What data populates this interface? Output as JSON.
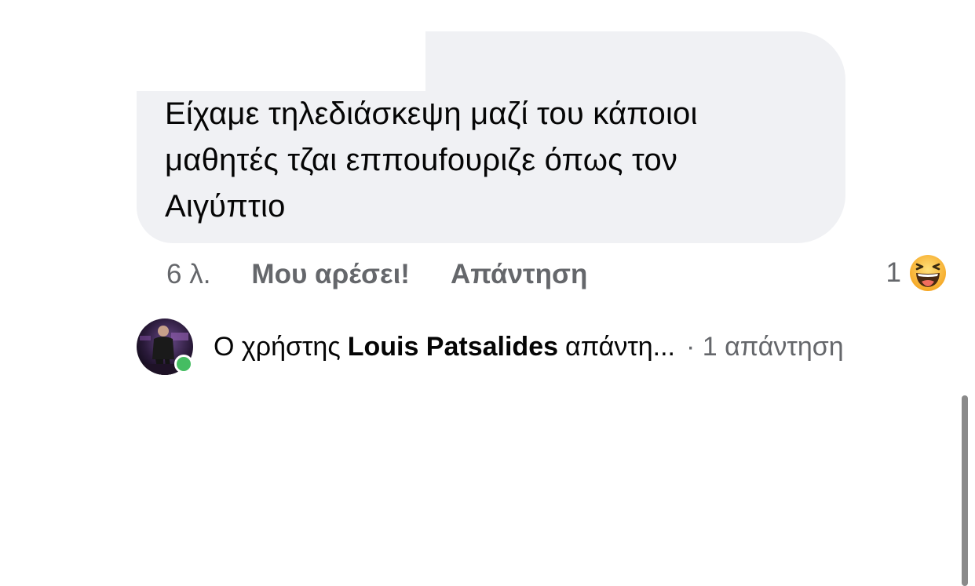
{
  "comment": {
    "line1": "Είχαμε τηλεδιάσκεψη μαζί του κάποιοι",
    "line2": "μαθητές τζαι επποufουριζε όπως τον",
    "line3": "Αιγύπτιο",
    "timestamp": "6 λ.",
    "like_label": "Μου αρέσει!",
    "reply_label": "Απάντηση",
    "reaction_count": "1",
    "reaction_icon": "laughing-face-icon"
  },
  "reply_preview": {
    "prefix": "Ο χρήστης",
    "name": "Louis Patsalides",
    "suffix": "απάντη...",
    "count_text": "· 1 απάντηση",
    "avatar_icon": "user-avatar",
    "online": true
  },
  "colors": {
    "bubble": "#f0f1f4",
    "secondary_text": "#65676b",
    "online": "#45bd62",
    "reaction": "#f7b125"
  }
}
